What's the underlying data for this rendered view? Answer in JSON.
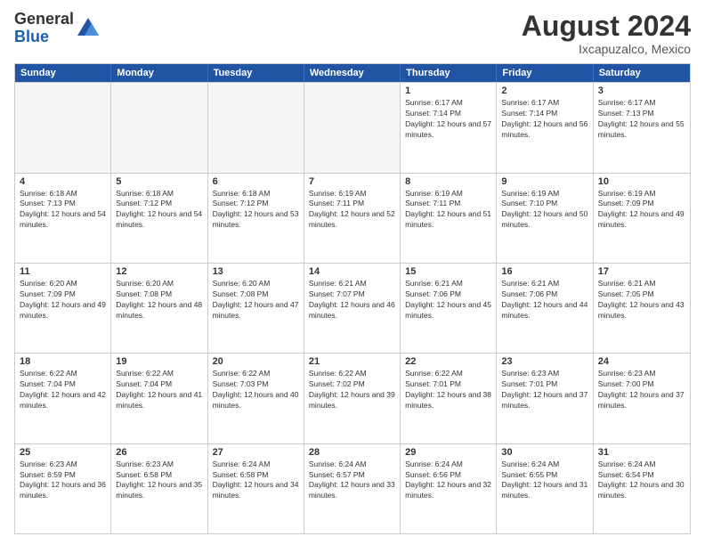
{
  "header": {
    "logo_general": "General",
    "logo_blue": "Blue",
    "month_year": "August 2024",
    "location": "Ixcapuzalco, Mexico"
  },
  "calendar": {
    "days_of_week": [
      "Sunday",
      "Monday",
      "Tuesday",
      "Wednesday",
      "Thursday",
      "Friday",
      "Saturday"
    ],
    "weeks": [
      [
        {
          "day": "",
          "empty": true
        },
        {
          "day": "",
          "empty": true
        },
        {
          "day": "",
          "empty": true
        },
        {
          "day": "",
          "empty": true
        },
        {
          "day": "1",
          "sunrise": "6:17 AM",
          "sunset": "7:14 PM",
          "daylight": "12 hours and 57 minutes."
        },
        {
          "day": "2",
          "sunrise": "6:17 AM",
          "sunset": "7:14 PM",
          "daylight": "12 hours and 56 minutes."
        },
        {
          "day": "3",
          "sunrise": "6:17 AM",
          "sunset": "7:13 PM",
          "daylight": "12 hours and 55 minutes."
        }
      ],
      [
        {
          "day": "4",
          "sunrise": "6:18 AM",
          "sunset": "7:13 PM",
          "daylight": "12 hours and 54 minutes."
        },
        {
          "day": "5",
          "sunrise": "6:18 AM",
          "sunset": "7:12 PM",
          "daylight": "12 hours and 54 minutes."
        },
        {
          "day": "6",
          "sunrise": "6:18 AM",
          "sunset": "7:12 PM",
          "daylight": "12 hours and 53 minutes."
        },
        {
          "day": "7",
          "sunrise": "6:19 AM",
          "sunset": "7:11 PM",
          "daylight": "12 hours and 52 minutes."
        },
        {
          "day": "8",
          "sunrise": "6:19 AM",
          "sunset": "7:11 PM",
          "daylight": "12 hours and 51 minutes."
        },
        {
          "day": "9",
          "sunrise": "6:19 AM",
          "sunset": "7:10 PM",
          "daylight": "12 hours and 50 minutes."
        },
        {
          "day": "10",
          "sunrise": "6:19 AM",
          "sunset": "7:09 PM",
          "daylight": "12 hours and 49 minutes."
        }
      ],
      [
        {
          "day": "11",
          "sunrise": "6:20 AM",
          "sunset": "7:09 PM",
          "daylight": "12 hours and 49 minutes."
        },
        {
          "day": "12",
          "sunrise": "6:20 AM",
          "sunset": "7:08 PM",
          "daylight": "12 hours and 48 minutes."
        },
        {
          "day": "13",
          "sunrise": "6:20 AM",
          "sunset": "7:08 PM",
          "daylight": "12 hours and 47 minutes."
        },
        {
          "day": "14",
          "sunrise": "6:21 AM",
          "sunset": "7:07 PM",
          "daylight": "12 hours and 46 minutes."
        },
        {
          "day": "15",
          "sunrise": "6:21 AM",
          "sunset": "7:06 PM",
          "daylight": "12 hours and 45 minutes."
        },
        {
          "day": "16",
          "sunrise": "6:21 AM",
          "sunset": "7:06 PM",
          "daylight": "12 hours and 44 minutes."
        },
        {
          "day": "17",
          "sunrise": "6:21 AM",
          "sunset": "7:05 PM",
          "daylight": "12 hours and 43 minutes."
        }
      ],
      [
        {
          "day": "18",
          "sunrise": "6:22 AM",
          "sunset": "7:04 PM",
          "daylight": "12 hours and 42 minutes."
        },
        {
          "day": "19",
          "sunrise": "6:22 AM",
          "sunset": "7:04 PM",
          "daylight": "12 hours and 41 minutes."
        },
        {
          "day": "20",
          "sunrise": "6:22 AM",
          "sunset": "7:03 PM",
          "daylight": "12 hours and 40 minutes."
        },
        {
          "day": "21",
          "sunrise": "6:22 AM",
          "sunset": "7:02 PM",
          "daylight": "12 hours and 39 minutes."
        },
        {
          "day": "22",
          "sunrise": "6:22 AM",
          "sunset": "7:01 PM",
          "daylight": "12 hours and 38 minutes."
        },
        {
          "day": "23",
          "sunrise": "6:23 AM",
          "sunset": "7:01 PM",
          "daylight": "12 hours and 37 minutes."
        },
        {
          "day": "24",
          "sunrise": "6:23 AM",
          "sunset": "7:00 PM",
          "daylight": "12 hours and 37 minutes."
        }
      ],
      [
        {
          "day": "25",
          "sunrise": "6:23 AM",
          "sunset": "6:59 PM",
          "daylight": "12 hours and 36 minutes."
        },
        {
          "day": "26",
          "sunrise": "6:23 AM",
          "sunset": "6:58 PM",
          "daylight": "12 hours and 35 minutes."
        },
        {
          "day": "27",
          "sunrise": "6:24 AM",
          "sunset": "6:58 PM",
          "daylight": "12 hours and 34 minutes."
        },
        {
          "day": "28",
          "sunrise": "6:24 AM",
          "sunset": "6:57 PM",
          "daylight": "12 hours and 33 minutes."
        },
        {
          "day": "29",
          "sunrise": "6:24 AM",
          "sunset": "6:56 PM",
          "daylight": "12 hours and 32 minutes."
        },
        {
          "day": "30",
          "sunrise": "6:24 AM",
          "sunset": "6:55 PM",
          "daylight": "12 hours and 31 minutes."
        },
        {
          "day": "31",
          "sunrise": "6:24 AM",
          "sunset": "6:54 PM",
          "daylight": "12 hours and 30 minutes."
        }
      ]
    ]
  }
}
